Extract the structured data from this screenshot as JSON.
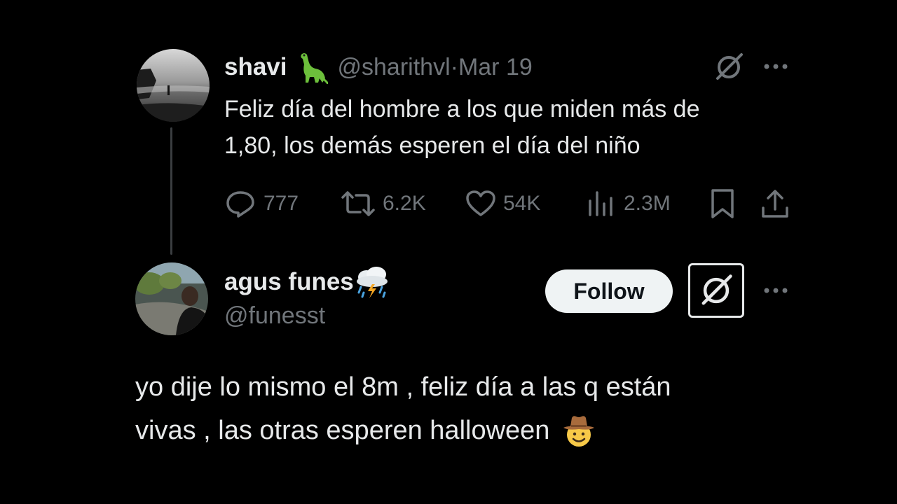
{
  "tweet1": {
    "name": "shavi",
    "name_emoji": "sauropod",
    "handle": "@sharithvl",
    "separator": " · ",
    "date": "Mar 19",
    "text_line1": "Feliz día del hombre a los que miden más de",
    "text_line2": "1,80, los demás esperen el día del niño",
    "metrics": {
      "replies": "777",
      "reposts": "6.2K",
      "likes": "54K",
      "views": "2.3M"
    }
  },
  "tweet2": {
    "name": "agus funes",
    "name_emoji": "cloud-with-lightning-and-rain",
    "handle": "@funesst",
    "follow_label": "Follow",
    "text_line1": "yo dije lo mismo el 8m , feliz día a las q están",
    "text_line2": "vivas , las otras esperen halloween",
    "text_emoji": "cowboy-hat-face"
  },
  "icons": {
    "grok": "grok-icon",
    "more": "more-icon",
    "reply": "reply-icon",
    "repost": "repost-icon",
    "like": "heart-icon",
    "views": "views-icon",
    "bookmark": "bookmark-icon",
    "share": "share-icon"
  },
  "colors": {
    "background": "#000000",
    "text_primary": "#e7e9ea",
    "text_secondary": "#71767b",
    "follow_bg": "#eff3f4",
    "follow_text": "#0f1419",
    "thread_line": "#3a3d40"
  }
}
